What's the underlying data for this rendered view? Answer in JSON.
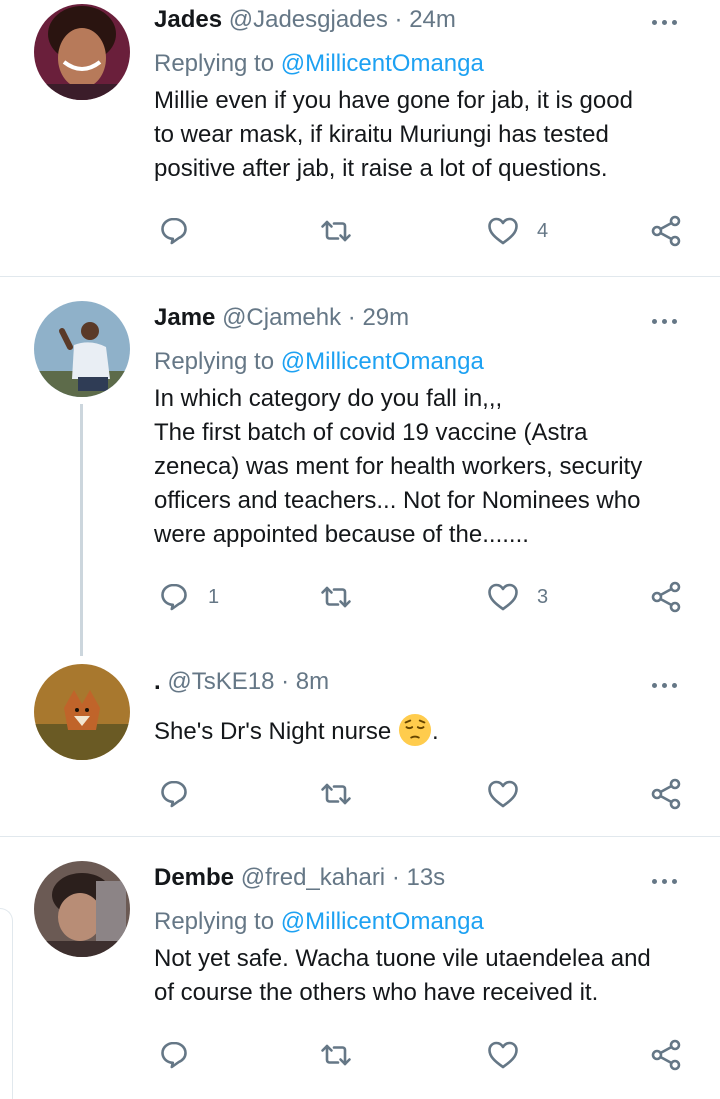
{
  "tweets": [
    {
      "name": "Jades",
      "handle": "@Jadesgjades",
      "time": "· 24m",
      "replying_prefix": "Replying to ",
      "replying_handle": "@MillicentOmanga",
      "text": "Millie even if you have gone for jab, it is good\nto wear mask, if kiraitu Muriungi has tested\npositive after jab, it raise a lot of questions.",
      "replies": "",
      "retweets": "",
      "likes": "4"
    },
    {
      "name": "Jame",
      "handle": "@Cjamehk",
      "time": "· 29m",
      "replying_prefix": "Replying to ",
      "replying_handle": "@MillicentOmanga",
      "text": "In which category do you fall in,,,\nThe first batch of covid 19 vaccine (Astra\nzeneca) was ment for health workers, security\nofficers and teachers... Not for Nominees who\nwere appointed because of the.......",
      "replies": "1",
      "retweets": "",
      "likes": "3"
    },
    {
      "name": ".",
      "handle": "@TsKE18",
      "time": "· 8m",
      "text_before": "She's Dr's Night nurse ",
      "text_after": ".",
      "emoji": "pensive-face",
      "replies": "",
      "retweets": "",
      "likes": ""
    },
    {
      "name": "Dembe",
      "handle": "@fred_kahari",
      "time": "· 13s",
      "replying_prefix": "Replying to ",
      "replying_handle": "@MillicentOmanga",
      "text": "Not yet safe. Wacha tuone vile utaendelea  and\nof course the others who have received it.",
      "replies": "",
      "retweets": "",
      "likes": ""
    }
  ],
  "colors": {
    "accent": "#1da1f2",
    "muted": "#657786",
    "divider": "#e1e8ed",
    "thread_line": "#ccd6dd"
  },
  "icons": [
    "reply-icon",
    "retweet-icon",
    "like-icon",
    "share-icon",
    "more-icon"
  ]
}
